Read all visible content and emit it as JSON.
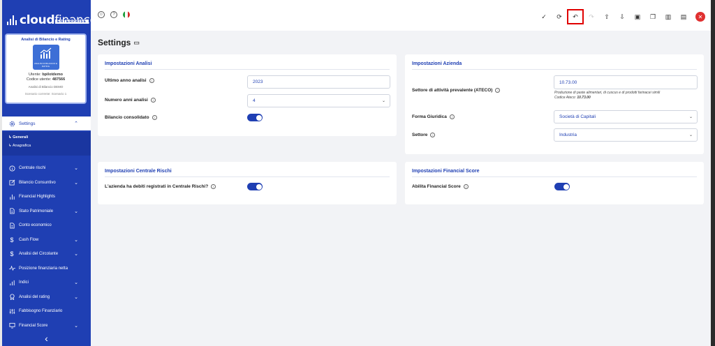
{
  "app": {
    "logo_bold": "cloud",
    "logo_thin": "finance",
    "logo_sub": "ENTERPRISE"
  },
  "profile": {
    "title": "Analisi di Bilancio e Rating",
    "logo_caption": "ANALISI DI BILANCIO E RATING",
    "user_label": "Utente:",
    "user_value": "bpilotdemo",
    "code_label": "Codice utente:",
    "code_value": "487566",
    "analysis": "Analisi di Bilancio DEMO",
    "scenario": "Scenario corrente: Scenario 1"
  },
  "sidebar": {
    "settings_label": "Settings",
    "sub_items": [
      "Generali",
      "Anagrafica"
    ],
    "items": [
      {
        "label": "Centrale rischi",
        "icon": "info-circle-icon",
        "chevron": true
      },
      {
        "label": "Bilancio Consuntivo",
        "icon": "edit-icon",
        "chevron": true
      },
      {
        "label": "Financial Highlights",
        "icon": "bar-chart-icon",
        "chevron": false
      },
      {
        "label": "Stato Patrimoniale",
        "icon": "document-icon",
        "chevron": true
      },
      {
        "label": "Conto economico",
        "icon": "document-icon",
        "chevron": false
      },
      {
        "label": "Cash Flow",
        "icon": "dollar-icon",
        "chevron": true
      },
      {
        "label": "Analisi del Circolante",
        "icon": "dollar-icon",
        "chevron": true
      },
      {
        "label": "Posizione finanziaria netta",
        "icon": "activity-icon",
        "chevron": false
      },
      {
        "label": "Indici",
        "icon": "bar-chart-icon",
        "chevron": true
      },
      {
        "label": "Analisi del rating",
        "icon": "award-icon",
        "chevron": true
      },
      {
        "label": "Fabbisogno Finanziario",
        "icon": "sliders-icon",
        "chevron": false
      },
      {
        "label": "Financial Score",
        "icon": "monitor-icon",
        "chevron": true
      }
    ]
  },
  "page": {
    "title": "Settings"
  },
  "analisi": {
    "heading": "Impostazioni Analisi",
    "ultimo_label": "Ultimo anno analisi",
    "ultimo_value": "2023",
    "numero_label": "Numero anni analisi",
    "numero_value": "4",
    "consolidato_label": "Bilancio consolidato",
    "consolidato_on": true
  },
  "azienda": {
    "heading": "Impostazioni Azienda",
    "ateco_label": "Settore di attività prevalente (ATECO)",
    "ateco_value": "10.73.00",
    "ateco_desc": "Produzione di paste alimentari, di cuscus e di prodotti farinacei simili",
    "ateco_code_label": "Codice Ateco:",
    "ateco_code_value": "10.73.00",
    "forma_label": "Forma Giuridica",
    "forma_value": "Società di Capitali",
    "settore_label": "Settore",
    "settore_value": "Industria"
  },
  "centrale": {
    "heading": "Impostazioni Centrale Rischi",
    "debiti_label": "L'azienda ha debiti registrati in Centrale Rischi?",
    "debiti_on": true
  },
  "score": {
    "heading": "Impostazioni Financial Score",
    "abilita_label": "Abilita Financial Score",
    "abilita_on": true
  }
}
